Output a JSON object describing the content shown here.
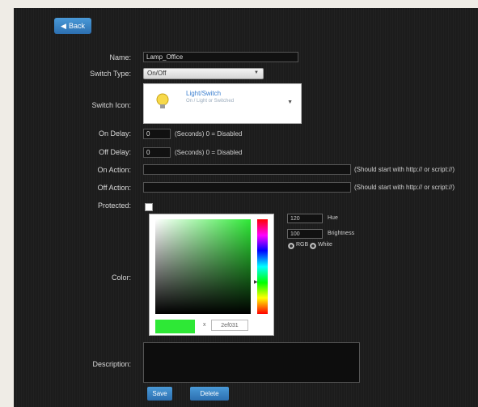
{
  "header": {
    "back_label": "Back"
  },
  "form": {
    "name_label": "Name:",
    "name_value": "Lamp_Office",
    "switch_type_label": "Switch Type:",
    "switch_type_value": "On/Off",
    "switch_icon_label": "Switch Icon:",
    "switch_icon_title": "Light/Switch",
    "switch_icon_subtitle": "On / Light or Switched",
    "on_delay_label": "On Delay:",
    "on_delay_value": "0",
    "off_delay_label": "Off Delay:",
    "off_delay_value": "0",
    "delay_hint": "(Seconds) 0 = Disabled",
    "on_action_label": "On Action:",
    "off_action_label": "Off Action:",
    "action_hint": "(Should start with http:// or script://)",
    "protected_label": "Protected:",
    "color_label": "Color:",
    "description_label": "Description:"
  },
  "color_picker": {
    "hue_value": "120",
    "hue_label": "Hue",
    "brightness_value": "100",
    "brightness_label": "Brightness",
    "mode_rgb": "RGB",
    "mode_white": "White",
    "hex_prefix": "x",
    "hex_value": "2ef031",
    "selected_color": "#2ee836"
  },
  "buttons": {
    "save_label": "Save",
    "delete_label": "Delete"
  },
  "colors": {
    "accent": "#2c6fb0",
    "panel_bg": "#1c1c1c"
  }
}
